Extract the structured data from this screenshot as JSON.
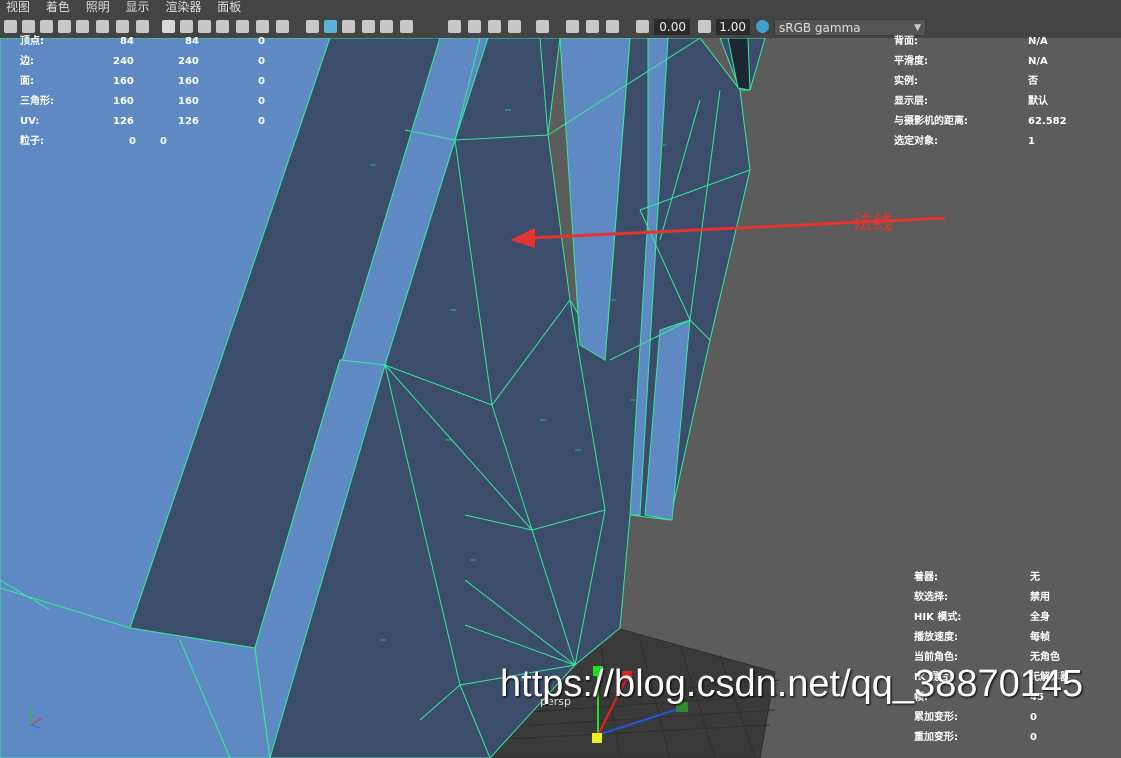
{
  "menu": [
    "视图",
    "着色",
    "照明",
    "显示",
    "渲染器",
    "面板"
  ],
  "toolbar": {
    "exposure_value": "0.00",
    "gamma_value": "1.00",
    "color_space": "sRGB gamma"
  },
  "hud_left": {
    "rows": [
      {
        "label": "顶点:",
        "a": "84",
        "b": "84",
        "c": "0"
      },
      {
        "label": "边:",
        "a": "240",
        "b": "240",
        "c": "0"
      },
      {
        "label": "面:",
        "a": "160",
        "b": "160",
        "c": "0"
      },
      {
        "label": "三角形:",
        "a": "160",
        "b": "160",
        "c": "0"
      },
      {
        "label": "UV:",
        "a": "126",
        "b": "126",
        "c": "0"
      },
      {
        "label": "粒子:",
        "a": "0",
        "b": "0",
        "c": ""
      }
    ]
  },
  "hud_right_top": {
    "rows": [
      {
        "label": "背面:",
        "value": "N/A"
      },
      {
        "label": "平滑度:",
        "value": "N/A"
      },
      {
        "label": "实例:",
        "value": "否"
      },
      {
        "label": "显示层:",
        "value": "默认"
      },
      {
        "label": "与摄影机的距离:",
        "value": "62.582"
      },
      {
        "label": "选定对象:",
        "value": "1"
      }
    ]
  },
  "hud_right_bottom": {
    "rows": [
      {
        "label": "着器:",
        "value": "无"
      },
      {
        "label": "软选择:",
        "value": "禁用"
      },
      {
        "label": "HIK 模式:",
        "value": "全身"
      },
      {
        "label": "播放速度:",
        "value": "每帧"
      },
      {
        "label": "当前角色:",
        "value": "无角色"
      },
      {
        "label": "IK 混合:",
        "value": "无解算器"
      },
      {
        "label": "帧:",
        "value": "45"
      },
      {
        "label": "累加变形:",
        "value": "0"
      },
      {
        "label": "重加变形:",
        "value": "0"
      }
    ]
  },
  "annotation": {
    "label": "法线",
    "color": "#e3342f"
  },
  "camera_label": "persp",
  "watermark": "https://blog.csdn.net/qq_38870145",
  "colors": {
    "mesh_face": "#3b4d6b",
    "mesh_face_light": "#5f89c3",
    "wire": "#34e89c",
    "background": "#5c5c5c"
  }
}
